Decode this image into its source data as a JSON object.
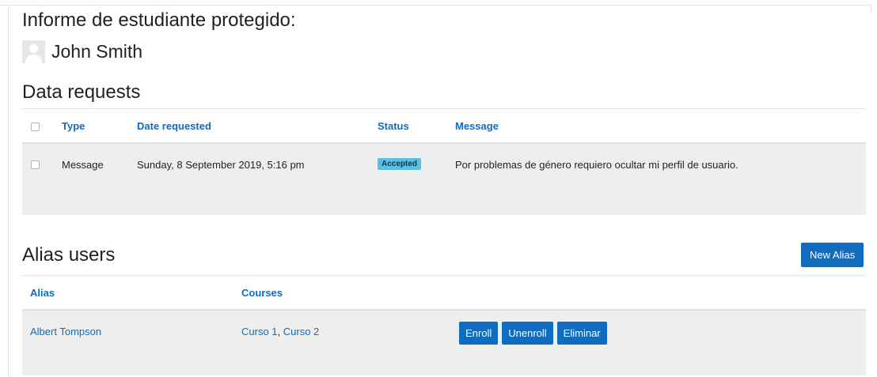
{
  "page": {
    "title": "Informe de estudiante protegido:"
  },
  "user": {
    "name": "John Smith"
  },
  "data_requests": {
    "title": "Data requests",
    "headers": {
      "type": "Type",
      "date": "Date requested",
      "status": "Status",
      "message": "Message"
    },
    "rows": [
      {
        "type": "Message",
        "date": "Sunday, 8 September 2019, 5:16 pm",
        "status": "Accepted",
        "message": "Por problemas de género requiero ocultar mi perfil de usuario."
      }
    ]
  },
  "alias_users": {
    "title": "Alias users",
    "new_button": "New Alias",
    "headers": {
      "alias": "Alias",
      "courses": "Courses"
    },
    "rows": [
      {
        "alias": "Albert Tompson",
        "course1": "Curso 1",
        "separator": ", ",
        "course2": "Curso 2",
        "actions": {
          "enroll": "Enroll",
          "unenroll": "Unenroll",
          "delete": "Eliminar"
        }
      }
    ]
  },
  "colors": {
    "accent": "#0f6cbf",
    "badge": "#5bc0de",
    "row_bg": "#eeeeee"
  }
}
